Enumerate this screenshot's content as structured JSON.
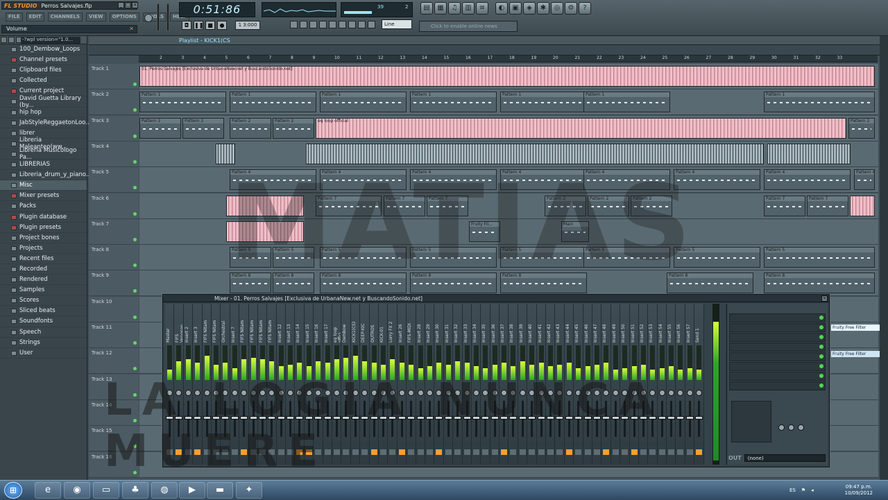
{
  "app": {
    "logo": "FL STUDIO",
    "project_title": "Perros Salvajes.flp"
  },
  "menu": [
    "FILE",
    "EDIT",
    "CHANNELS",
    "VIEW",
    "OPTIONS",
    "TOOLS",
    "HELP"
  ],
  "hint": {
    "text": "Volume"
  },
  "transport": {
    "time": "0:51:86",
    "tempo": "1 3:000",
    "snap": "Line",
    "news": "Click to enable online news",
    "scope_left": "39",
    "scope_right": "2"
  },
  "browser": {
    "header": "-?wpl version=\"1.0...",
    "items": [
      {
        "label": "100_Dembow_Loops",
        "red": false
      },
      {
        "label": "Channel presets",
        "red": true
      },
      {
        "label": "Clipboard files",
        "red": false
      },
      {
        "label": "Collected",
        "red": false
      },
      {
        "label": "Current project",
        "red": true
      },
      {
        "label": "David Guetta Library (by...",
        "red": false
      },
      {
        "label": "hip hop",
        "red": false
      },
      {
        "label": "JabStyleReggaetonLoo...",
        "red": false
      },
      {
        "label": "librer",
        "red": false
      },
      {
        "label": "Libreria Maleanteo(ww...",
        "red": false
      },
      {
        "label": "Libreria Musicologo Pa...",
        "red": false
      },
      {
        "label": "LIBRERIAS",
        "red": false
      },
      {
        "label": "Libreria_drum_y_piano...",
        "red": false
      },
      {
        "label": "Misc",
        "red": false,
        "selected": true
      },
      {
        "label": "Mixer presets",
        "red": true
      },
      {
        "label": "Packs",
        "red": false
      },
      {
        "label": "Plugin database",
        "red": true
      },
      {
        "label": "Plugin presets",
        "red": true
      },
      {
        "label": "Project bones",
        "red": false
      },
      {
        "label": "Projects",
        "red": false
      },
      {
        "label": "Recent files",
        "red": false
      },
      {
        "label": "Recorded",
        "red": false
      },
      {
        "label": "Rendered",
        "red": false
      },
      {
        "label": "Samples",
        "red": false
      },
      {
        "label": "Scores",
        "red": false
      },
      {
        "label": "Sliced beats",
        "red": false
      },
      {
        "label": "Soundfonts",
        "red": false
      },
      {
        "label": "Speech",
        "red": false
      },
      {
        "label": "Strings",
        "red": false
      },
      {
        "label": "User",
        "red": false
      }
    ]
  },
  "playlist": {
    "title": "Playlist - KICK1(CS",
    "tracks": [
      "Track 1",
      "Track 2",
      "Track 3",
      "Track 4",
      "Track 5",
      "Track 6",
      "Track 7",
      "Track 8",
      "Track 9",
      "Track 10",
      "Track 11",
      "Track 12",
      "Track 13",
      "Track 14",
      "Track 15",
      "Track 16"
    ],
    "ruler": [
      "2",
      "3",
      "4",
      "5",
      "6",
      "7",
      "8",
      "9",
      "10",
      "11",
      "12",
      "13",
      "14",
      "15",
      "16",
      "17",
      "18",
      "19",
      "20",
      "21",
      "22",
      "23",
      "24",
      "25",
      "26",
      "27",
      "28",
      "29",
      "30",
      "31",
      "32",
      "33"
    ],
    "audio_clip": "01. Perros Salvajes [Exclusiva de UrbanaNew.net y BuscandoSonido.net]",
    "clip_labels": {
      "p1": "Pattern 1",
      "p2": "Pattern 2",
      "p4": "Pattern 4",
      "p5": "Pattern 5",
      "p7": "Pattern 7",
      "p8": "Pattern 8",
      "loop": "eq loop official",
      "fruity": "Fruity Fil...",
      "main": "Main"
    }
  },
  "mixer": {
    "title": "Mixer - 01. Perros Salvajes [Exclusiva de UrbanaNew.net y BuscandoSonido.net]",
    "out_label": "OUT",
    "out_value": "(none)",
    "strip_names": [
      "Master",
      "FIFS Vengean",
      "Insert 2",
      "Insert 3",
      "FIFS Nitam",
      "FIFS Nitam",
      "Orchestral",
      "Insert 7",
      "FIFS Nitam",
      "FIFS Nitam",
      "FIFS Nitam",
      "FIFS Nitam",
      "Insert 12",
      "Insert 13",
      "Insert 14",
      "Insert 15",
      "Insert 16",
      "Insert 17",
      "eq loop offici",
      "Dembow",
      "KICK1(CS)",
      "DEEP-KIC",
      "OUTROS",
      "KICK-01",
      "Lorry FX 2",
      "Insert 26",
      "FIFS-MIDI",
      "Insert 28",
      "Insert 29",
      "Insert 30",
      "Insert 31",
      "Insert 32",
      "Insert 33",
      "Insert 34",
      "Insert 35",
      "Insert 36",
      "Insert 37",
      "Insert 38",
      "Insert 39",
      "Insert 40",
      "Insert 41",
      "Insert 42",
      "Insert 43",
      "Insert 44",
      "Insert 45",
      "Insert 46",
      "Insert 47",
      "Insert 48",
      "Insert 49",
      "Insert 50",
      "Insert 51",
      "Insert 52",
      "Insert 53",
      "Insert 54",
      "Insert 55",
      "Insert 56",
      "Insert 57",
      "Send 1"
    ],
    "meter_levels": [
      0.3,
      0.55,
      0.6,
      0.5,
      0.7,
      0.45,
      0.5,
      0.35,
      0.6,
      0.65,
      0.6,
      0.55,
      0.4,
      0.45,
      0.5,
      0.4,
      0.55,
      0.5,
      0.6,
      0.65,
      0.7,
      0.55,
      0.5,
      0.45,
      0.6,
      0.5,
      0.45,
      0.35,
      0.4,
      0.5,
      0.45,
      0.55,
      0.5,
      0.4,
      0.35,
      0.45,
      0.5,
      0.4,
      0.55,
      0.45,
      0.5,
      0.4,
      0.45,
      0.5,
      0.35,
      0.4,
      0.45,
      0.5,
      0.3,
      0.35,
      0.4,
      0.45,
      0.3,
      0.35,
      0.4,
      0.3,
      0.35,
      0.3
    ],
    "fx_slots": 8
  },
  "side_fx": [
    "Fruity Free Filter (Insert",
    "Fruity Free Filter (Insert"
  ],
  "overlay": {
    "line1": "MATIAS",
    "line2": "LA LOGIA NUNCA MUERE"
  },
  "taskbar": {
    "lang": "ES",
    "time": "09:47 p.m.",
    "date": "10/09/2012"
  }
}
